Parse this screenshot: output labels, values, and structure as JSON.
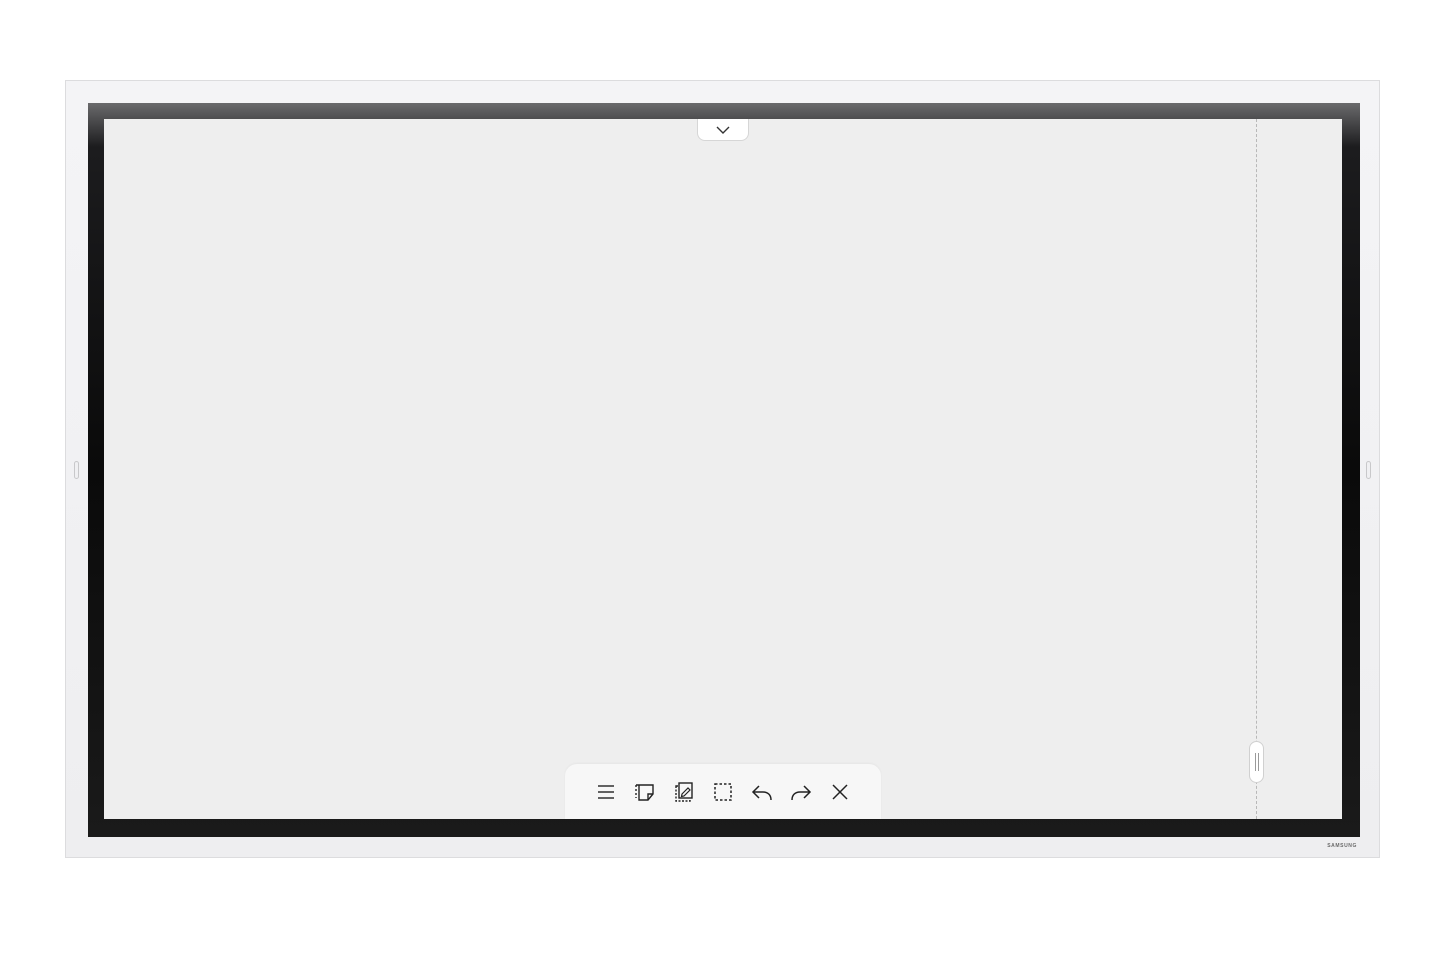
{
  "device": {
    "brand_label": "SAMSUNG",
    "screen_color": "#eeeeee",
    "frame_color": "#f2f2f4"
  },
  "top_tab": {
    "icon": "chevron-down-icon"
  },
  "toolbar": {
    "tools": [
      {
        "id": "menu",
        "icon": "menu-icon"
      },
      {
        "id": "sticky-note",
        "icon": "sticky-note-icon"
      },
      {
        "id": "import",
        "icon": "import-page-icon"
      },
      {
        "id": "select",
        "icon": "selection-icon"
      },
      {
        "id": "undo",
        "icon": "undo-icon"
      },
      {
        "id": "redo",
        "icon": "redo-icon"
      },
      {
        "id": "close",
        "icon": "close-icon"
      }
    ]
  },
  "scroll_handle": {
    "icon": "drag-handle-icon"
  }
}
